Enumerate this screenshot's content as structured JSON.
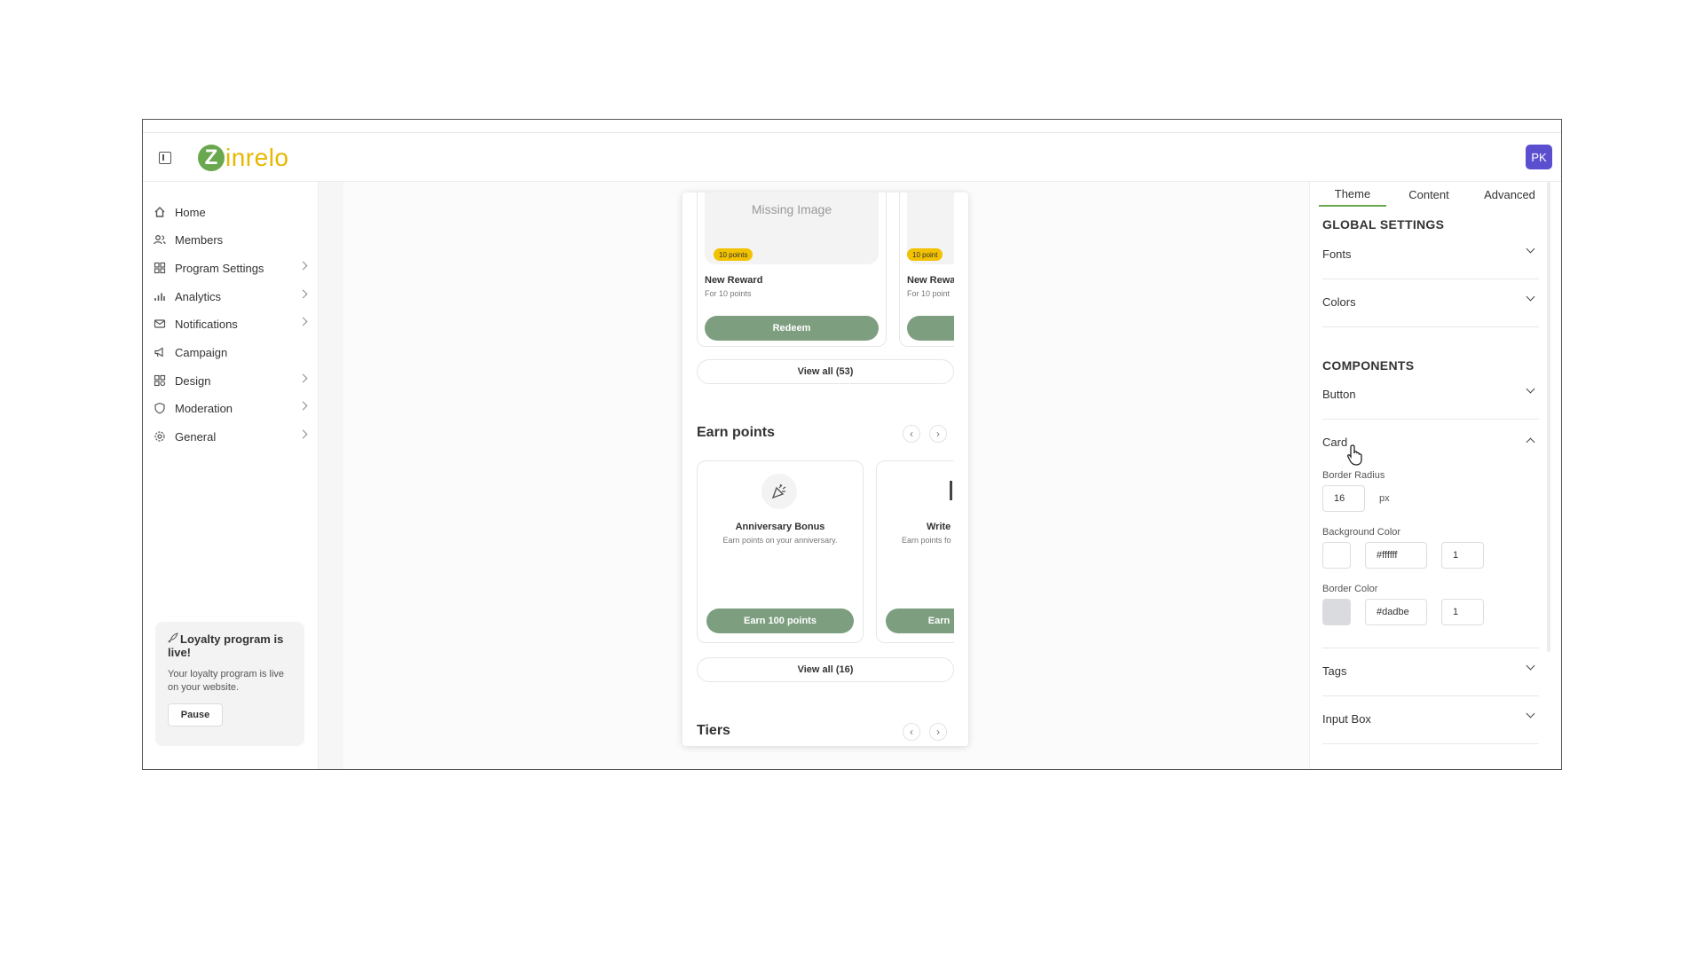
{
  "header": {
    "logo_letter": "Z",
    "logo_text": "inrelo",
    "avatar": "PK"
  },
  "sidebar": {
    "items": [
      {
        "label": "Home",
        "icon": "home-icon",
        "has_children": false
      },
      {
        "label": "Members",
        "icon": "members-icon",
        "has_children": false
      },
      {
        "label": "Program Settings",
        "icon": "program-settings-icon",
        "has_children": true
      },
      {
        "label": "Analytics",
        "icon": "analytics-icon",
        "has_children": true
      },
      {
        "label": "Notifications",
        "icon": "notifications-icon",
        "has_children": true
      },
      {
        "label": "Campaign",
        "icon": "campaign-icon",
        "has_children": false
      },
      {
        "label": "Design",
        "icon": "design-icon",
        "has_children": true
      },
      {
        "label": "Moderation",
        "icon": "moderation-icon",
        "has_children": true
      },
      {
        "label": "General",
        "icon": "general-icon",
        "has_children": true
      }
    ],
    "live_card": {
      "title": "Loyalty program is live!",
      "description": "Your loyalty program is live on your website.",
      "pause_label": "Pause"
    }
  },
  "preview": {
    "rewards": [
      {
        "image_text": "Missing Image",
        "badge": "10 points",
        "title": "New Reward",
        "subtitle": "For 10 points",
        "button": "Redeem"
      },
      {
        "image_text": "",
        "badge": "10 point",
        "title": "New Rewa",
        "subtitle": "For 10 point",
        "button": ""
      }
    ],
    "rewards_view_all": "View all (53)",
    "earn_heading": "Earn points",
    "earn": [
      {
        "title": "Anniversary Bonus",
        "subtitle": "Earn points on your anniversary.",
        "button": "Earn 100 points"
      },
      {
        "title": "Write",
        "subtitle": "Earn points fo",
        "button": "Earn"
      }
    ],
    "earn_view_all": "View all (16)",
    "tiers_heading": "Tiers",
    "arrow_prev": "‹",
    "arrow_next": "›"
  },
  "panel": {
    "tabs": [
      "Theme",
      "Content",
      "Advanced"
    ],
    "active_tab": "Theme",
    "global_title": "GLOBAL SETTINGS",
    "fonts_label": "Fonts",
    "colors_label": "Colors",
    "components_title": "COMPONENTS",
    "button_label": "Button",
    "card_label": "Card",
    "card": {
      "border_radius_label": "Border Radius",
      "border_radius_value": "16",
      "border_radius_unit": "px",
      "background_color_label": "Background Color",
      "background_color_hex": "#ffffff",
      "background_opacity": "1",
      "border_color_label": "Border Color",
      "border_color_hex": "#dadbe",
      "border_opacity": "1"
    },
    "tags_label": "Tags",
    "inputbox_label": "Input Box"
  },
  "colors": {
    "accent_green": "#6aa84f",
    "button_green": "#7d9e7f",
    "badge_yellow": "#f2c200",
    "avatar_purple": "#5b4fcf",
    "card_bg_swatch": "#ffffff",
    "border_swatch": "#dadbde"
  }
}
